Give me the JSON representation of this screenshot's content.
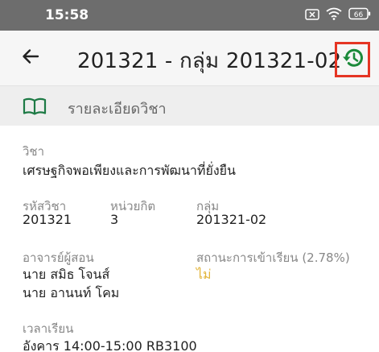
{
  "status_bar": {
    "time": "15:58",
    "battery": "66",
    "icons": [
      "close-box-icon",
      "wifi-icon",
      "battery-icon"
    ]
  },
  "app_bar": {
    "back_icon": "arrow-left-icon",
    "title": "201321 - กลุ่ม 201321-02",
    "history_icon": "history-icon",
    "history_color": "#1b8a3a",
    "highlight_color": "#e53524"
  },
  "section": {
    "icon": "book-icon",
    "title": "รายละเอียดวิชา"
  },
  "details": {
    "subject_label": "วิชา",
    "subject_value": "เศรษฐกิจพอเพียงและการพัฒนาที่ยั่งยืน",
    "code_label": "รหัสวิชา",
    "code_value": "201321",
    "credit_label": "หน่วยกิต",
    "credit_value": "3",
    "group_label": "กลุ่ม",
    "group_value": "201321-02",
    "instructor_label": "อาจารย์ผู้สอน",
    "instructors": [
      "นาย สมิธ โจนส์",
      "นาย อานนท์ โคม"
    ],
    "attendance_label": "สถานะการเข้าเรียน (2.78%)",
    "attendance_value": "ไม่",
    "attendance_color": "#e2b43a",
    "time_label": "เวลาเรียน",
    "time_value": "อังคาร  14:00-15:00  RB3100"
  }
}
